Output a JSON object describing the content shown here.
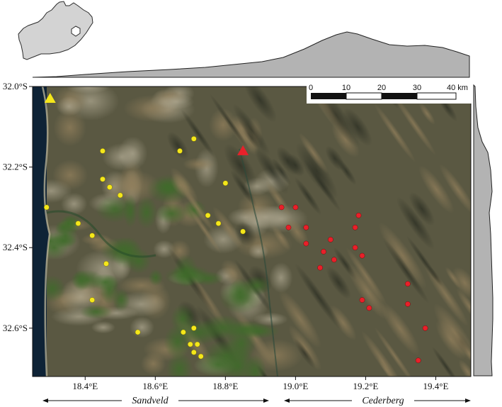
{
  "map": {
    "lon_range": [
      18.25,
      19.5
    ],
    "lat_range": [
      -32.72,
      -32.0
    ],
    "lon_ticks": [
      {
        "value": 18.4,
        "label": "18.4°E"
      },
      {
        "value": 18.6,
        "label": "18.6°E"
      },
      {
        "value": 18.8,
        "label": "18.8°E"
      },
      {
        "value": 19.0,
        "label": "19.0°E"
      },
      {
        "value": 19.2,
        "label": "19.2°E"
      },
      {
        "value": 19.4,
        "label": "19.4°E"
      }
    ],
    "lat_ticks": [
      {
        "value": -32.0,
        "label": "32.0°S"
      },
      {
        "value": -32.2,
        "label": "32.2°S"
      },
      {
        "value": -32.4,
        "label": "32.4°S"
      },
      {
        "value": -32.6,
        "label": "32.6°S"
      }
    ],
    "scale_bar": {
      "labels": [
        "0",
        "10",
        "20",
        "30",
        "40 km"
      ]
    },
    "regions": {
      "west": "Sandveld",
      "east": "Cederberg"
    },
    "colors": {
      "yellow_sites": "#f5e71a",
      "red_sites": "#e8202a",
      "profile_fill": "#b3b3b3",
      "inset_land": "#d3d3d3"
    },
    "yellow_reference": {
      "lon": 18.3,
      "lat": -32.03
    },
    "red_reference": {
      "lon": 18.85,
      "lat": -32.16
    },
    "yellow_sites": [
      {
        "lon": 18.29,
        "lat": -32.3
      },
      {
        "lon": 18.45,
        "lat": -32.16
      },
      {
        "lon": 18.45,
        "lat": -32.23
      },
      {
        "lon": 18.47,
        "lat": -32.25
      },
      {
        "lon": 18.5,
        "lat": -32.27
      },
      {
        "lon": 18.38,
        "lat": -32.34
      },
      {
        "lon": 18.42,
        "lat": -32.37
      },
      {
        "lon": 18.46,
        "lat": -32.44
      },
      {
        "lon": 18.42,
        "lat": -32.53
      },
      {
        "lon": 18.55,
        "lat": -32.61
      },
      {
        "lon": 18.67,
        "lat": -32.16
      },
      {
        "lon": 18.71,
        "lat": -32.13
      },
      {
        "lon": 18.8,
        "lat": -32.24
      },
      {
        "lon": 18.75,
        "lat": -32.32
      },
      {
        "lon": 18.78,
        "lat": -32.34
      },
      {
        "lon": 18.85,
        "lat": -32.36
      },
      {
        "lon": 18.68,
        "lat": -32.61
      },
      {
        "lon": 18.71,
        "lat": -32.6
      },
      {
        "lon": 18.7,
        "lat": -32.64
      },
      {
        "lon": 18.72,
        "lat": -32.64
      },
      {
        "lon": 18.71,
        "lat": -32.66
      },
      {
        "lon": 18.73,
        "lat": -32.67
      }
    ],
    "red_sites": [
      {
        "lon": 18.96,
        "lat": -32.3
      },
      {
        "lon": 19.0,
        "lat": -32.3
      },
      {
        "lon": 18.98,
        "lat": -32.35
      },
      {
        "lon": 19.03,
        "lat": -32.35
      },
      {
        "lon": 19.03,
        "lat": -32.39
      },
      {
        "lon": 19.08,
        "lat": -32.41
      },
      {
        "lon": 19.1,
        "lat": -32.38
      },
      {
        "lon": 19.11,
        "lat": -32.43
      },
      {
        "lon": 19.07,
        "lat": -32.45
      },
      {
        "lon": 19.17,
        "lat": -32.35
      },
      {
        "lon": 19.18,
        "lat": -32.32
      },
      {
        "lon": 19.17,
        "lat": -32.4
      },
      {
        "lon": 19.19,
        "lat": -32.42
      },
      {
        "lon": 19.19,
        "lat": -32.53
      },
      {
        "lon": 19.21,
        "lat": -32.55
      },
      {
        "lon": 19.32,
        "lat": -32.49
      },
      {
        "lon": 19.32,
        "lat": -32.54
      },
      {
        "lon": 19.37,
        "lat": -32.6
      },
      {
        "lon": 19.35,
        "lat": -32.68
      }
    ]
  }
}
